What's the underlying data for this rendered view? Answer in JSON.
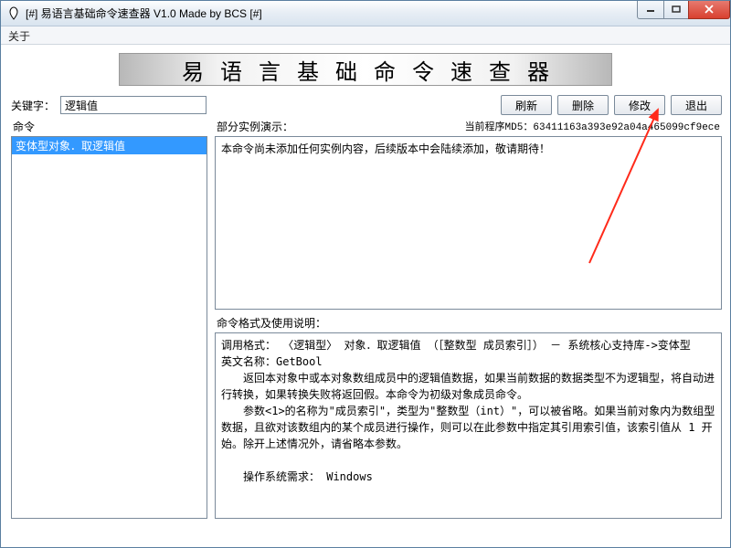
{
  "window": {
    "title": "[#] 易语言基础命令速查器 V1.0 Made by BCS [#]"
  },
  "menubar": {
    "about": "关于"
  },
  "banner": "易语言基础命令速查器",
  "keyword": {
    "label": "关键字：",
    "value": "逻辑值"
  },
  "buttons": {
    "refresh": "刷新",
    "delete": "删除",
    "modify": "修改",
    "exit": "退出"
  },
  "left": {
    "label": "命令",
    "items": [
      "变体型对象．取逻辑值"
    ]
  },
  "right": {
    "demo_label": "部分实例演示：",
    "md5": "当前程序MD5：63411163a393e92a04a465099cf9ece",
    "demo_text": "本命令尚未添加任何实例内容，后续版本中会陆续添加，敬请期待！",
    "format_label": "命令格式及使用说明：",
    "format_lines": [
      "调用格式： 〈逻辑型〉 对象．取逻辑值 （［整数型 成员索引］） － 系统核心支持库->变体型",
      "英文名称：GetBool",
      "　　返回本对象中或本对象数组成员中的逻辑值数据，如果当前数据的数据类型不为逻辑型，将自动进行转换，如果转换失败将返回假。本命令为初级对象成员命令。",
      "　　参数<1>的名称为\"成员索引\"，类型为\"整数型（int）\"，可以被省略。如果当前对象内为数组型数据，且欲对该数组内的某个成员进行操作，则可以在此参数中指定其引用索引值，该索引值从 1 开始。除开上述情况外，请省略本参数。",
      "　　操作系统需求： Windows"
    ]
  }
}
